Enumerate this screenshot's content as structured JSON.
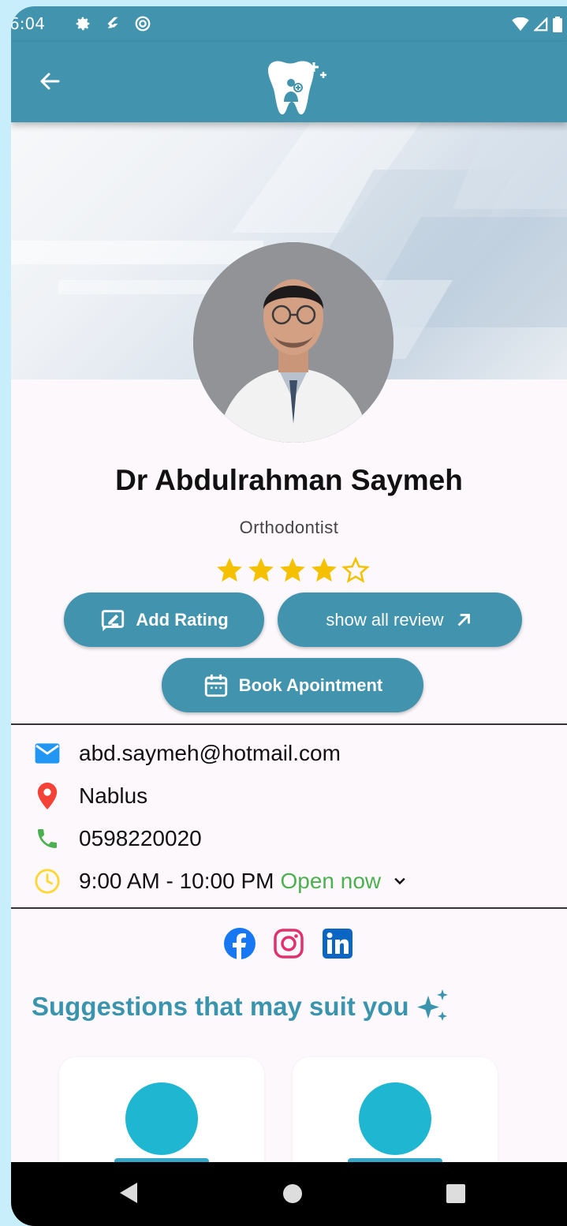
{
  "status_bar": {
    "time": "6:04",
    "left_icons": [
      "gear-icon",
      "flutter-icon",
      "sync-icon"
    ],
    "right_icons": [
      "wifi-icon",
      "signal-icon",
      "battery-icon"
    ]
  },
  "app_bar": {
    "back_icon": "arrow-back-icon",
    "logo_icon": "tooth-logo-icon",
    "color": "#4193ae"
  },
  "doctor": {
    "name": "Dr Abdulrahman Saymeh",
    "specialty": "Orthodontist",
    "rating": 4,
    "rating_max": 5
  },
  "buttons": {
    "add_rating": "Add Rating",
    "show_reviews": "show all review",
    "book": "Book Apointment"
  },
  "contact": {
    "email": "abd.saymeh@hotmail.com",
    "location": "Nablus",
    "phone": "0598220020",
    "hours": "9:00 AM - 10:00 PM",
    "open_status": "Open now"
  },
  "socials": [
    "facebook-icon",
    "instagram-icon",
    "linkedin-icon"
  ],
  "suggestions": {
    "title": "Suggestions that may suit you"
  },
  "colors": {
    "primary": "#4193ae",
    "star": "#f5c000",
    "open": "#4caf50",
    "suggest_title": "#3a94ad",
    "card_avatar": "#1fb6d2"
  }
}
